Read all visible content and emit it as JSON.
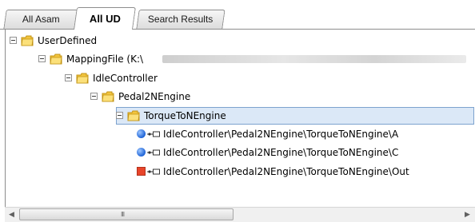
{
  "tabs": [
    {
      "label": "All Asam",
      "active": false
    },
    {
      "label": "All UD",
      "active": true
    },
    {
      "label": "Search Results",
      "active": false
    }
  ],
  "tree": {
    "root": "UserDefined",
    "mapping_file": "MappingFile (K:\\",
    "idle_controller": "IdleController",
    "pedal": "Pedal2NEngine",
    "torque": "TorqueToNEngine",
    "ports": [
      {
        "label": "IdleController\\Pedal2NEngine\\TorqueToNEngine\\A",
        "kind": "input",
        "icon": "blue-circle-icon"
      },
      {
        "label": "IdleController\\Pedal2NEngine\\TorqueToNEngine\\C",
        "kind": "input",
        "icon": "blue-circle-icon"
      },
      {
        "label": "IdleController\\Pedal2NEngine\\TorqueToNEngine\\Out",
        "kind": "output",
        "icon": "red-square-icon"
      }
    ]
  },
  "scrollbar": {
    "left_arrow": "◀",
    "right_arrow": "▶",
    "grip": "III"
  },
  "colors": {
    "selection_fill": "#dbe8f7",
    "selection_border": "#7da2ce",
    "folder": "#f2c43d"
  }
}
